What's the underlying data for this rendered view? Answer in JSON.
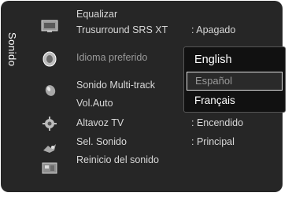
{
  "sidebar": {
    "category_label": "Sonido",
    "icons": [
      "picture-icon",
      "sound-icon",
      "channel-icon",
      "setup-icon",
      "input-icon",
      "application-icon"
    ]
  },
  "menu": {
    "items": [
      {
        "label": "Equalizar",
        "value": ""
      },
      {
        "label": "Trusurround SRS XT",
        "value": ": Apagado"
      },
      {
        "label": "Idioma preferido",
        "value": ""
      },
      {
        "label": "Sonido Multi-track",
        "value": ""
      },
      {
        "label": "Vol.Auto",
        "value": ""
      },
      {
        "label": "Altavoz TV",
        "value": ": Encendido"
      },
      {
        "label": "Sel. Sonido",
        "value": ": Principal"
      },
      {
        "label": "Reinicio del sonido",
        "value": ""
      }
    ]
  },
  "language_dropdown": {
    "options": [
      "English",
      "Español",
      "Français"
    ],
    "highlighted": "Español"
  }
}
